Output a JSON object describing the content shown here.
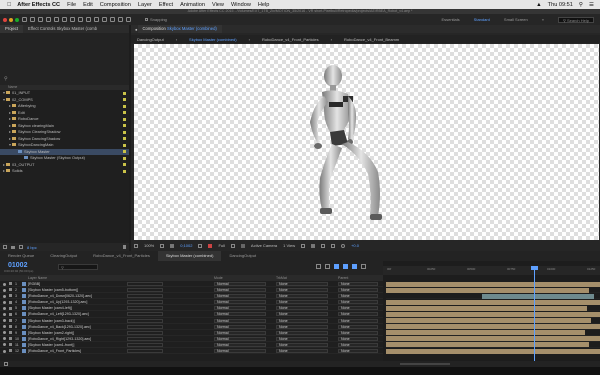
{
  "menubar": {
    "app": "After Effects CC",
    "items": [
      "File",
      "Edit",
      "Composition",
      "Layer",
      "Effect",
      "Animation",
      "View",
      "Window",
      "Help"
    ],
    "clock": "Thu 09:51"
  },
  "titlebar": "Adobe After Effects CC 2015 - /Volumes/EXT_1TB_Ziv/MOTION_35/2016 - VR short-Pixelbull/Retropedia/projects/AE/RBEA_Robot_v4.aep *",
  "toolbar": {
    "snapping": "Snapping",
    "workspaces": [
      "Essentials",
      "Standard",
      "Small Screen"
    ],
    "active_workspace": "Standard",
    "search": "Search Help"
  },
  "project": {
    "tabs": [
      "Project",
      "Effect Controls Skybox Master (comb"
    ],
    "header": "Name",
    "items": [
      {
        "label": "01_INPUT",
        "type": "folder",
        "depth": 0,
        "open": true
      },
      {
        "label": "02_COMPS",
        "type": "folder",
        "depth": 0,
        "open": true
      },
      {
        "label": "Afterbying",
        "type": "folder",
        "depth": 1
      },
      {
        "label": "Edit",
        "type": "folder",
        "depth": 1
      },
      {
        "label": "RoboDance",
        "type": "folder",
        "depth": 1
      },
      {
        "label": "Skybox clearingMain",
        "type": "folder",
        "depth": 1
      },
      {
        "label": "Skybox ClearingShadow",
        "type": "folder",
        "depth": 1
      },
      {
        "label": "Skybox DancingShadow",
        "type": "folder",
        "depth": 1
      },
      {
        "label": "SkyboxDancingMain",
        "type": "folder",
        "depth": 1,
        "open": true
      },
      {
        "label": "Skybox Master",
        "type": "comp",
        "depth": 2
      },
      {
        "label": "Skybox Master (Skybox Output)",
        "type": "comp",
        "depth": 3
      },
      {
        "label": "03_OUTPUT",
        "type": "folder",
        "depth": 0
      },
      {
        "label": "Solids",
        "type": "folder",
        "depth": 0
      }
    ],
    "footer_bpc": "8 bpc"
  },
  "viewer": {
    "panel_title": "Composition",
    "active_comp": "Skybox Master (combined)",
    "comp_tabs": [
      "DancingOutput",
      "Skybox Master (combined)",
      "RoboDance_v4_Front_Particles",
      "RoboDance_v4_Front_Beamm"
    ],
    "active_comp_tab": "Skybox Master (combined)",
    "zoom": "100%",
    "timecode": "0;1002",
    "resolution": "Full",
    "camera": "Active Camera",
    "views": "1 View",
    "exposure": "+0.0"
  },
  "timeline_tabs": [
    "Render Queue",
    "ClearingOutput",
    "RoboDance_v4_Front_Particles",
    "Skybox Master (combined)",
    "DancingOutput"
  ],
  "active_timeline_tab": "Skybox Master (combined)",
  "timeline": {
    "current_time": "01002",
    "time_sub": "0:00:20:02 (50.00 fps)",
    "columns": {
      "layer_name": "Layer Name",
      "mode": "Mode",
      "trkmat": "TrkMat",
      "parent": "Parent"
    },
    "ruler_labels": [
      "00f",
      "00250",
      "00500",
      "00750",
      "01000",
      "01250"
    ],
    "playhead_fraction": 0.69,
    "layers": [
      {
        "num": "1",
        "name": "[RGBB]",
        "mode": "Normal",
        "trk": "None",
        "parent": "None",
        "bar_start": 0.0,
        "bar_end": 1.0,
        "bar_type": "footage"
      },
      {
        "num": "2",
        "name": "[Skybox Master (cam5-bottom)]",
        "mode": "Normal",
        "trk": "None",
        "parent": "None",
        "bar_start": 0.0,
        "bar_end": 0.95,
        "bar_type": "footage"
      },
      {
        "num": "3",
        "name": "[RoboDance_v4_Down[0620-1320].aec]",
        "mode": "Normal",
        "trk": "None",
        "parent": "None",
        "bar_start": 0.45,
        "bar_end": 0.97,
        "bar_type": "teal"
      },
      {
        "num": "4",
        "name": "[RoboDance_v4_Up[1293-1320].aec]",
        "mode": "Normal",
        "trk": "None",
        "parent": "None",
        "bar_start": 0.0,
        "bar_end": 1.0,
        "bar_type": "footage"
      },
      {
        "num": "5",
        "name": "[Skybox Master (cam4-left)]",
        "mode": "Normal",
        "trk": "None",
        "parent": "None",
        "bar_start": 0.0,
        "bar_end": 0.94,
        "bar_type": "footage"
      },
      {
        "num": "6",
        "name": "[RoboDance_v4_Left[1293-1320].aec]",
        "mode": "Normal",
        "trk": "None",
        "parent": "None",
        "bar_start": 0.0,
        "bar_end": 1.0,
        "bar_type": "footage"
      },
      {
        "num": "7",
        "name": "[Skybox Master (cam3-back)]",
        "mode": "Normal",
        "trk": "None",
        "parent": "None",
        "bar_start": 0.0,
        "bar_end": 0.96,
        "bar_type": "footage"
      },
      {
        "num": "8",
        "name": "[RoboDance_v4_Back[1293-1320].aec]",
        "mode": "Normal",
        "trk": "None",
        "parent": "None",
        "bar_start": 0.0,
        "bar_end": 1.0,
        "bar_type": "footage"
      },
      {
        "num": "9",
        "name": "[Skybox Master (cam2-right)]",
        "mode": "Normal",
        "trk": "None",
        "parent": "None",
        "bar_start": 0.0,
        "bar_end": 0.93,
        "bar_type": "footage"
      },
      {
        "num": "10",
        "name": "[RoboDance_v4_Right[1293-1320].aec]",
        "mode": "Normal",
        "trk": "None",
        "parent": "None",
        "bar_start": 0.0,
        "bar_end": 1.0,
        "bar_type": "footage"
      },
      {
        "num": "11",
        "name": "[Skybox Master (cam1-front)]",
        "mode": "Normal",
        "trk": "None",
        "parent": "None",
        "bar_start": 0.0,
        "bar_end": 0.95,
        "bar_type": "footage"
      },
      {
        "num": "12",
        "name": "[RoboDance_v4_Front_Particles]",
        "mode": "Normal",
        "trk": "None",
        "parent": "None",
        "bar_start": 0.0,
        "bar_end": 1.0,
        "bar_type": "footage"
      }
    ]
  },
  "colors": {
    "accent": "#5ea0ff",
    "footage_bar": "#a58f6b",
    "teal_bar": "#6e8a8e",
    "label_yellow": "#c9c248"
  }
}
